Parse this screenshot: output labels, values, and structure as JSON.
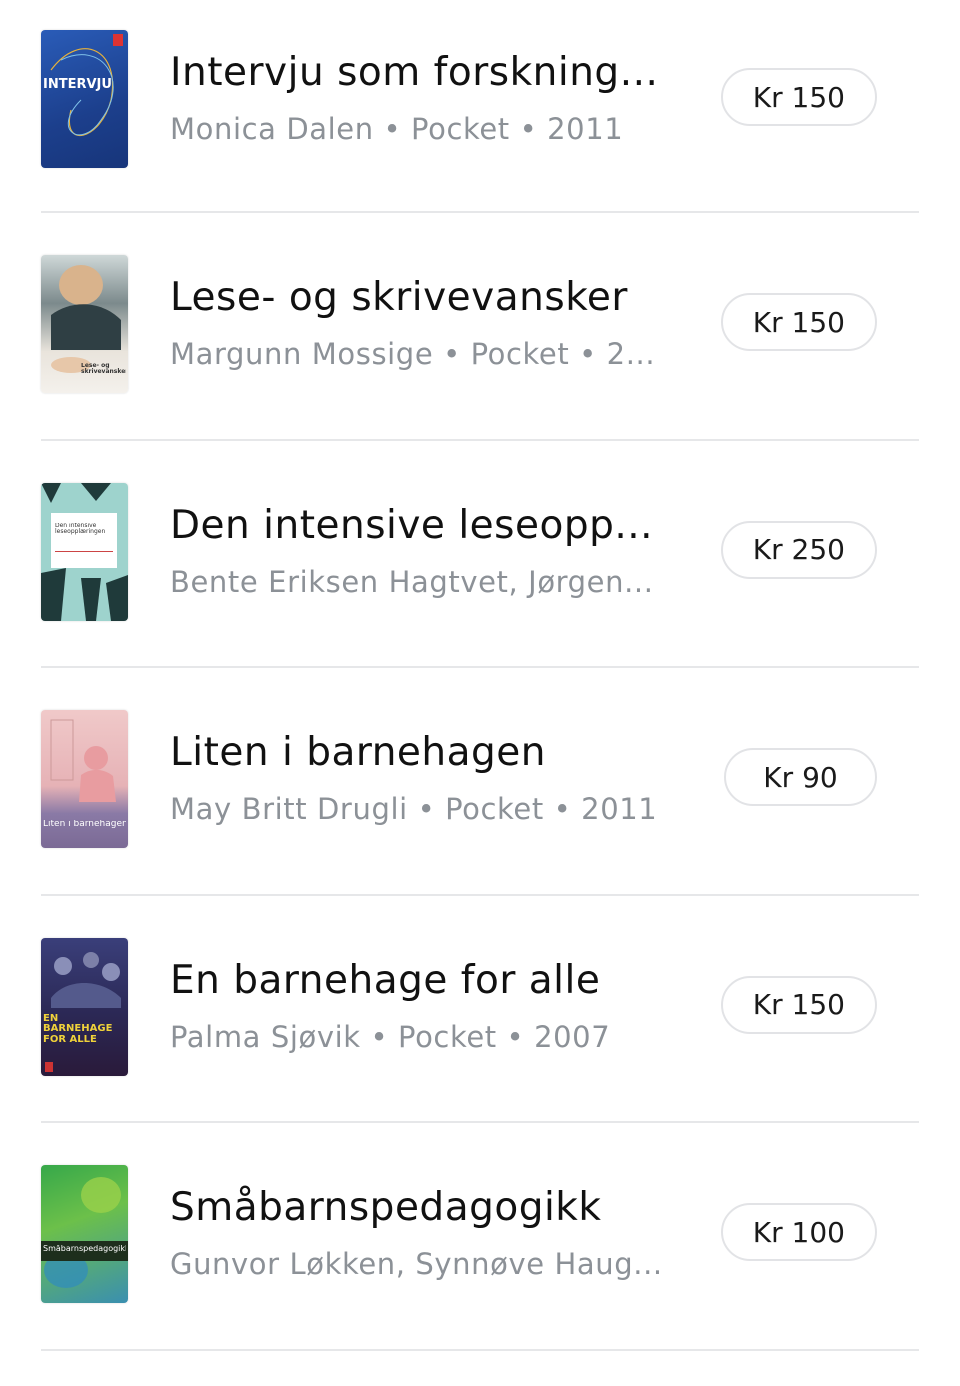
{
  "books": [
    {
      "title": "Intervju som forskning...",
      "meta": "Monica Dalen • Pocket • 2011",
      "price": "Kr 150",
      "cover_text": "INTERVJU",
      "cover_color": "#1f4ea3"
    },
    {
      "title": "Lese- og skrivevansker",
      "meta": "Margunn Mossige • Pocket • 2...",
      "price": "Kr 150",
      "cover_text": "Lese- og skrivevansker",
      "cover_color": "#f2efe9"
    },
    {
      "title": "Den intensive leseopp...",
      "meta": "Bente Eriksen Hagtvet, Jørgen...",
      "price": "Kr 250",
      "cover_text": "Den intensive leseopplæringen",
      "cover_color": "#9fd6d0"
    },
    {
      "title": "Liten i barnehagen",
      "meta": "May Britt Drugli • Pocket • 2011",
      "price": "Kr 90",
      "cover_text": "Liten i barnehagen",
      "cover_color": "#d9a8b0"
    },
    {
      "title": "En barnehage for alle",
      "meta": "Palma Sjøvik • Pocket • 2007",
      "price": "Kr 150",
      "cover_text": "EN BARNEHAGE FOR ALLE",
      "cover_color": "#2a2350"
    },
    {
      "title": "Småbarnspedagogikk",
      "meta": "Gunvor Løkken, Synnøve Haug...",
      "price": "Kr 100",
      "cover_text": "Småbarnspedagogikk",
      "cover_color": "#4fb04a"
    }
  ]
}
